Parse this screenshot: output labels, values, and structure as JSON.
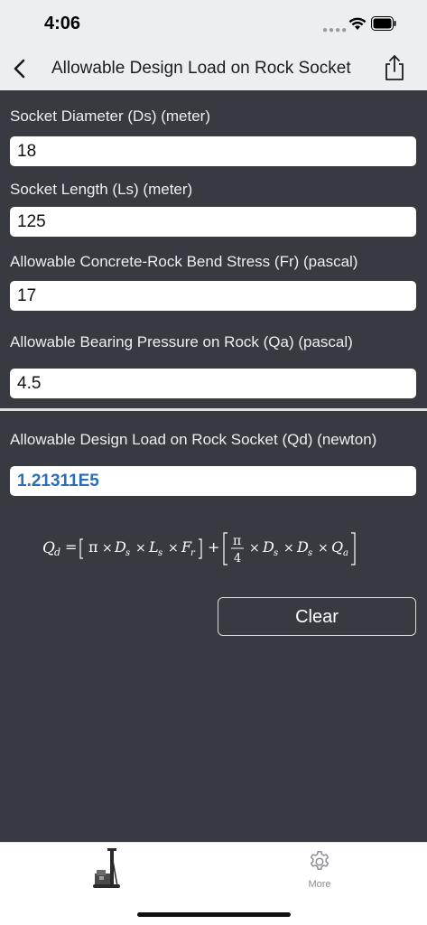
{
  "status_bar": {
    "time": "4:06"
  },
  "nav": {
    "title": "Allowable Design Load on Rock Socket",
    "back_icon": "chevron-left-icon",
    "share_icon": "share-icon"
  },
  "fields": [
    {
      "label": "Socket Diameter (Ds) (meter)",
      "value": "18"
    },
    {
      "label": "Socket Length (Ls) (meter)",
      "value": "125"
    },
    {
      "label": "Allowable Concrete-Rock Bend Stress (Fr) (pascal)",
      "value": "17"
    },
    {
      "label": "Allowable Bearing Pressure on Rock (Qa) (pascal)",
      "value": "4.5"
    }
  ],
  "result": {
    "label": "Allowable Design Load on Rock Socket (Qd) (newton)",
    "value": "1.21311E5"
  },
  "formula": {
    "lhs": "Q",
    "lhs_sub": "d",
    "eq": "=",
    "term1_pi": "π",
    "times": "×",
    "D": "D",
    "s": "s",
    "L": "L",
    "F": "F",
    "r": "r",
    "plus": "+",
    "frac_num": "π",
    "frac_den": "4",
    "Q": "Q",
    "a": "a"
  },
  "buttons": {
    "clear": "Clear"
  },
  "tab_bar": {
    "rig_icon": "drilling-rig-icon",
    "more_label": "More",
    "more_icon": "gear-icon"
  },
  "colors": {
    "content_bg": "#373a40",
    "nav_bg": "#eceff1",
    "result_text": "#2c6db3"
  }
}
